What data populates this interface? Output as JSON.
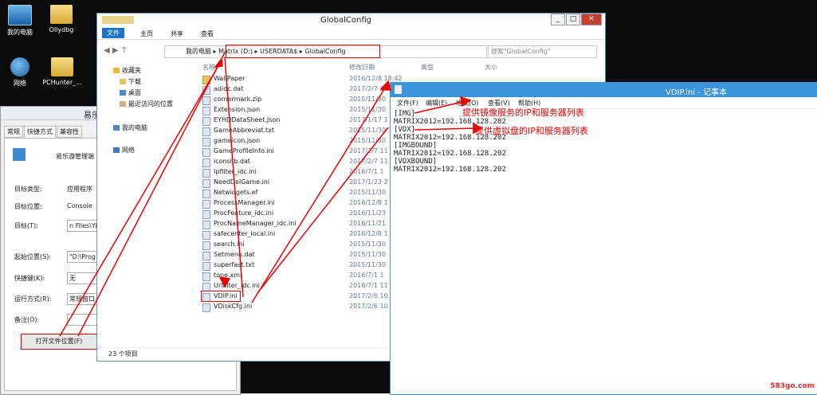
{
  "desktop": {
    "icons": [
      {
        "label": "我的电脑",
        "icon": "computer-icon"
      },
      {
        "label": "Ollydbg",
        "icon": "folder-icon"
      },
      {
        "label": "网络",
        "icon": "network-icon"
      },
      {
        "label": "PCHunter_...",
        "icon": "folder-icon"
      }
    ]
  },
  "properties": {
    "title": "易乐",
    "tabs": [
      "常规",
      "快捷方式",
      "兼容性"
    ],
    "app_name": "易乐游管理端",
    "rows": [
      {
        "label": "目标类型:",
        "value": "应用程序"
      },
      {
        "label": "目标位置:",
        "value": "Console"
      },
      {
        "label": "目标(T):",
        "value": "n Files\\Yi"
      },
      {
        "label": "起始位置(S):",
        "value": "\"D:\\Prog"
      },
      {
        "label": "快捷键(K):",
        "value": "无"
      },
      {
        "label": "运行方式(R):",
        "value": "常规窗口"
      },
      {
        "label": "备注(O):",
        "value": ""
      }
    ],
    "open_location_button": "打开文件位置(F)"
  },
  "explorer": {
    "title": "GlobalConfig",
    "ribbon": [
      "文件",
      "主页",
      "共享",
      "查看"
    ],
    "breadcrumbs": [
      "我的电脑",
      "Matrix (D:)",
      "USERDATA$",
      "GlobalConfig"
    ],
    "search_placeholder": "搜索\"GlobalConfig\"",
    "columns": [
      "名称",
      "修改日期",
      "类型",
      "大小"
    ],
    "nav": {
      "favorites": "收藏夹",
      "download": "下载",
      "desktop": "桌面",
      "recent": "最近访问的位置",
      "computer": "我的电脑",
      "network": "网络"
    },
    "files": [
      {
        "name": "WallPaper",
        "date": "2016/12/8 18:42",
        "folder": true
      },
      {
        "name": "adidc.dat",
        "date": "2017/2/7 11"
      },
      {
        "name": "cornermark.zip",
        "date": "2015/11/30"
      },
      {
        "name": "Extension.json",
        "date": "2015/11/30"
      },
      {
        "name": "EYHDDataSheet.Json",
        "date": "2017/1/17 1"
      },
      {
        "name": "GameAbbreviat.txt",
        "date": "2015/11/30"
      },
      {
        "name": "gameicon.json",
        "date": "2015/11/30"
      },
      {
        "name": "GameProfileInfo.ini",
        "date": "2017/2/7 11"
      },
      {
        "name": "iconslib.dat",
        "date": "2017/2/7 11"
      },
      {
        "name": "Ipfilter_idc.ini",
        "date": "2016/7/1 1"
      },
      {
        "name": "NeedDelGame.ini",
        "date": "2017/1/23 2"
      },
      {
        "name": "Netwidgets.ef",
        "date": "2015/11/30"
      },
      {
        "name": "ProcessManager.ini",
        "date": "2016/12/8 1"
      },
      {
        "name": "ProcFeature_idc.ini",
        "date": "2016/11/23"
      },
      {
        "name": "ProcNameManager_idc.ini",
        "date": "2016/11/21"
      },
      {
        "name": "safecenter_local.ini",
        "date": "2016/12/8 1"
      },
      {
        "name": "search.ini",
        "date": "2015/11/30"
      },
      {
        "name": "Setmenu.dat",
        "date": "2015/11/30"
      },
      {
        "name": "superfast.txt",
        "date": "2015/11/30"
      },
      {
        "name": "tone.xml",
        "date": "2016/7/1 1"
      },
      {
        "name": "Urlfilter_idc.ini",
        "date": "2016/7/1 11"
      },
      {
        "name": "VDIP.ini",
        "date": "2017/2/6 10"
      },
      {
        "name": "VDiskCfg.ini",
        "date": "2017/2/6 10"
      }
    ],
    "status": "23 个项目"
  },
  "notepad": {
    "title": "VDIP.ini - 记事本",
    "menu": [
      "文件(F)",
      "编辑(E)",
      "格式(O)",
      "查看(V)",
      "帮助(H)"
    ],
    "lines": [
      "[IMG]",
      "MATRIX2012=192.168.128.202",
      "[VDX]",
      "MATRIX2012=192.168.128.202",
      "[IMGBOUND]",
      "MATRIX2012=192.168.128.202",
      "[VDXBOUND]",
      "MATRIX2012=192.168.128.202"
    ]
  },
  "annotations": {
    "img_note": "提供镜像服务的IP和服务器列表",
    "vdx_note": "提供虚拟盘的IP和服务器列表"
  },
  "watermark": "583go.com"
}
